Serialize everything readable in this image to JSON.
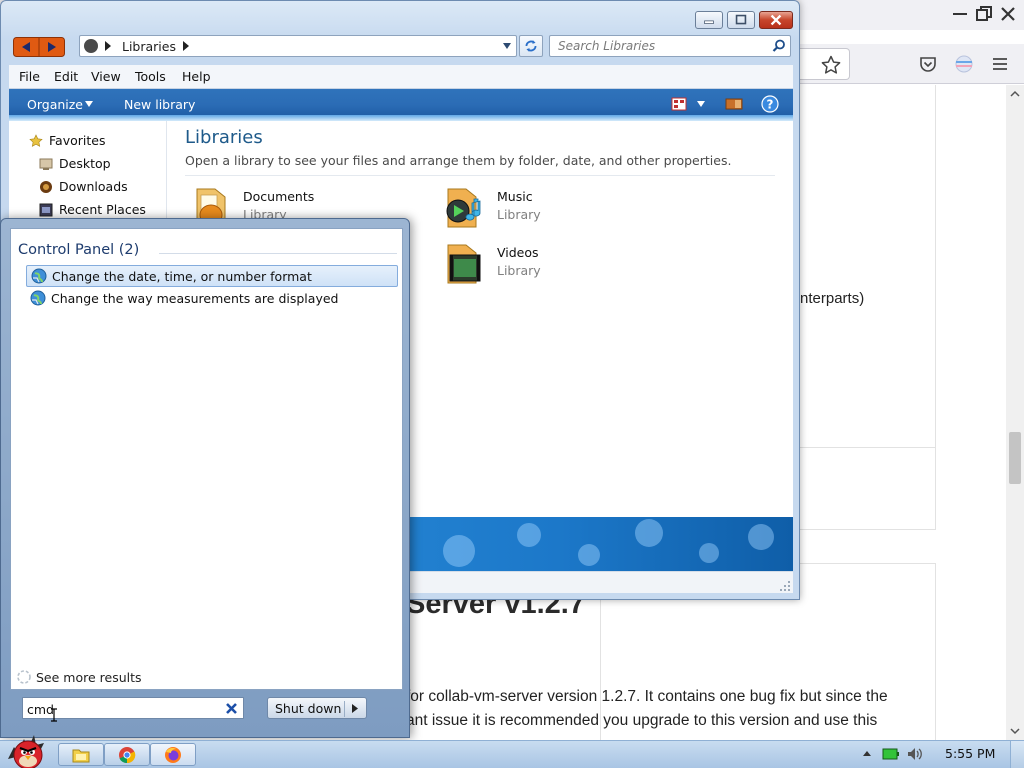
{
  "browser": {
    "page": {
      "paragraph_fragment": "nterparts)",
      "release_title": "Server v1.2.7",
      "release_body_line1": "for collab-vm-server version 1.2.7. It contains one bug fix but since the",
      "release_body_line2": "ant issue it is recommended you upgrade to this version and use this"
    },
    "icons": [
      "minimize-icon",
      "restore-icon",
      "close-icon",
      "star-icon",
      "pocket-icon",
      "account-icon",
      "menu-icon"
    ]
  },
  "explorer": {
    "address": {
      "crumb": "Libraries"
    },
    "search": {
      "placeholder": "Search Libraries"
    },
    "menu": {
      "file": "File",
      "edit": "Edit",
      "view": "View",
      "tools": "Tools",
      "help": "Help"
    },
    "commands": {
      "organize": "Organize",
      "new_library": "New library"
    },
    "nav": {
      "favorites": "Favorites",
      "desktop": "Desktop",
      "downloads": "Downloads",
      "recent_places": "Recent Places"
    },
    "content": {
      "heading": "Libraries",
      "subtitle": "Open a library to see your files and arrange them by folder, date, and other properties.",
      "libraries": [
        {
          "name": "Documents",
          "kind": "Library"
        },
        {
          "name": "Music",
          "kind": "Library"
        },
        {
          "name": "Videos",
          "kind": "Library"
        }
      ]
    }
  },
  "start_menu": {
    "group_header": "Control Panel (2)",
    "results": [
      "Change the date, time, or number format",
      "Change the way measurements are displayed"
    ],
    "see_more": "See more results",
    "search_value": "cmd",
    "shutdown_label": "Shut down"
  },
  "taskbar": {
    "clock": "5:55 PM"
  },
  "colors": {
    "explorer_heading": "#1e5a8a",
    "command_bar": "#2b6cb5",
    "result_highlight": "#cfe2f7"
  }
}
